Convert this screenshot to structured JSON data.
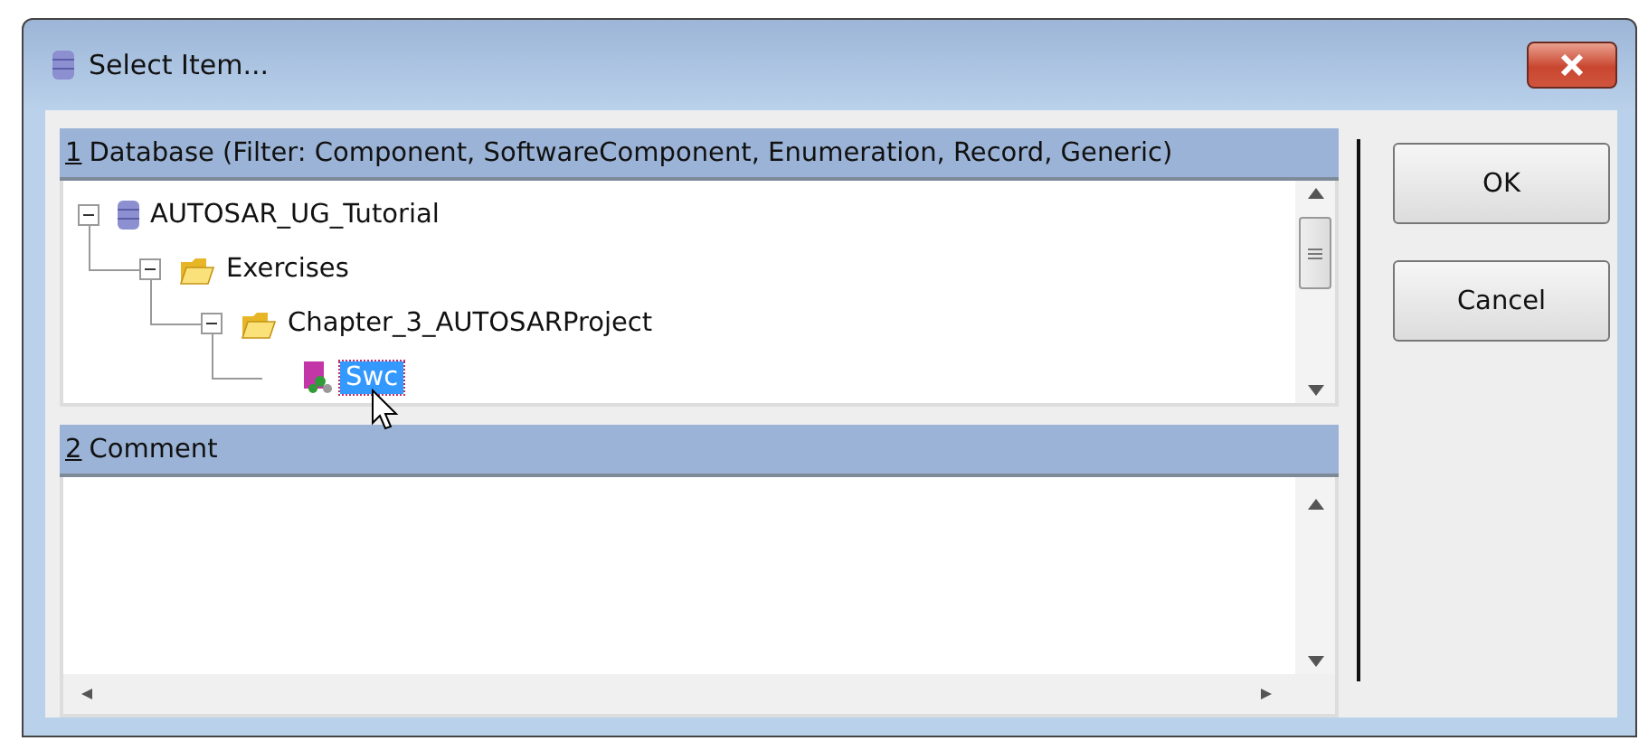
{
  "window": {
    "title": "Select Item..."
  },
  "database_panel": {
    "key": "1",
    "label": "Database (Filter: Component, SoftwareComponent, Enumeration, Record, Generic)",
    "tree": [
      {
        "label": "AUTOSAR_UG_Tutorial",
        "kind": "database",
        "expanded": true,
        "selected": false,
        "children": [
          {
            "label": "Exercises",
            "kind": "folder",
            "expanded": true,
            "selected": false,
            "children": [
              {
                "label": "Chapter_3_AUTOSARProject",
                "kind": "folder",
                "expanded": true,
                "selected": false,
                "children": [
                  {
                    "label": "Swc",
                    "kind": "component",
                    "selected": true
                  }
                ]
              }
            ]
          }
        ]
      }
    ]
  },
  "comment_panel": {
    "key": "2",
    "label": "Comment"
  },
  "buttons": [
    "OK",
    "Cancel"
  ]
}
